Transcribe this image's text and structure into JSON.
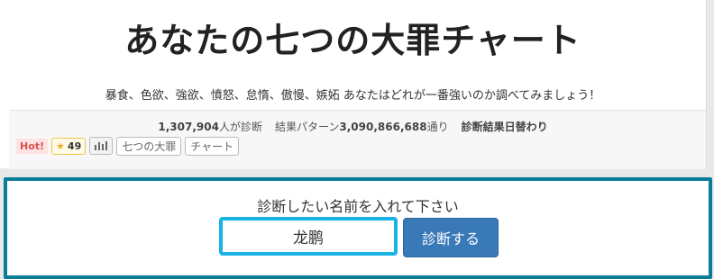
{
  "header": {
    "title": "あなたの七つの大罪チャート",
    "description": "暴食、色欲、強欲、憤怒、怠惰、傲慢、嫉妬 あなたはどれが一番強いのか調べてみましょう！"
  },
  "stats": {
    "count": "1,307,904",
    "count_suffix": "人が診断",
    "patterns_prefix": "結果パターン",
    "patterns": "3,090,866,688",
    "patterns_suffix": "通り",
    "daily_change": "診断結果日替わり"
  },
  "tags": {
    "hot": "Hot!",
    "fav_count": "49",
    "items": [
      "七つの大罪",
      "チャート"
    ]
  },
  "form": {
    "label": "診断したい名前を入れて下さい",
    "name_value": "龙鹏",
    "submit_label": "診断する"
  },
  "colors": {
    "form_border": "#0a7c98",
    "input_border": "#19b3e6",
    "button": "#3a79b7",
    "hot": "#d9534f"
  }
}
